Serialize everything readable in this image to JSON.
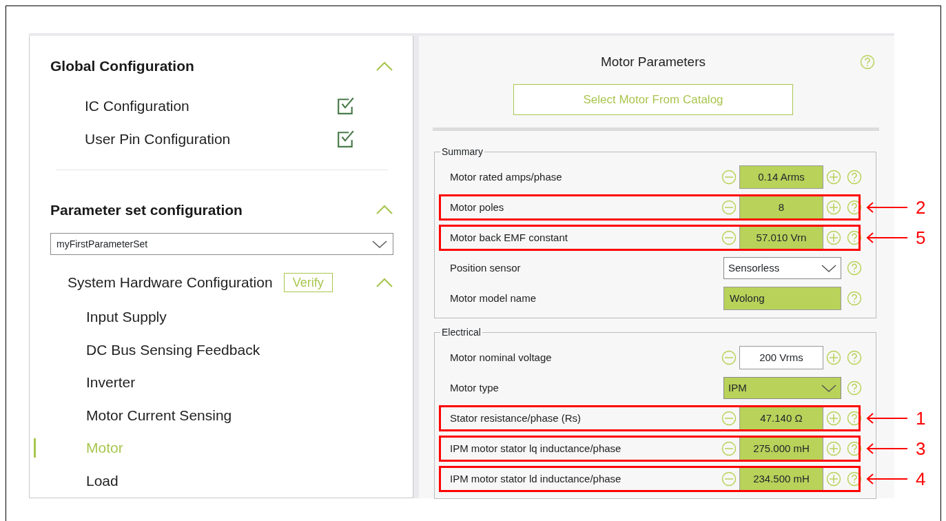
{
  "sidebar": {
    "sections": [
      {
        "title": "Global Configuration",
        "expanded": true,
        "items": [
          {
            "label": "IC Configuration",
            "checked": true
          },
          {
            "label": "User Pin Configuration",
            "checked": true
          }
        ]
      },
      {
        "title": "Parameter set configuration",
        "expanded": true,
        "parameter_set": "myFirstParameterSet",
        "subsection": {
          "title": "System Hardware Configuration",
          "verify_button": "Verify",
          "expanded": true,
          "items": [
            {
              "label": "Input Supply",
              "selected": false
            },
            {
              "label": "DC Bus Sensing Feedback",
              "selected": false
            },
            {
              "label": "Inverter",
              "selected": false
            },
            {
              "label": "Motor Current Sensing",
              "selected": false
            },
            {
              "label": "Motor",
              "selected": true
            },
            {
              "label": "Load",
              "selected": false
            }
          ]
        }
      }
    ]
  },
  "panel": {
    "title": "Motor Parameters",
    "catalog_button": "Select Motor From Catalog",
    "groups": [
      {
        "title": "Summary",
        "rows": [
          {
            "kind": "spin",
            "label": "Motor rated amps/phase",
            "value": "0.14 Arms",
            "changed": true
          },
          {
            "kind": "spin",
            "label": "Motor poles",
            "value": "8",
            "changed": true,
            "callout": "2"
          },
          {
            "kind": "spin",
            "label": "Motor back EMF constant",
            "value": "57.010 Vrn",
            "changed": true,
            "callout": "5"
          },
          {
            "kind": "select",
            "label": "Position sensor",
            "value": "Sensorless",
            "changed": false
          },
          {
            "kind": "text",
            "label": "Motor model name",
            "value": "Wolong",
            "changed": true
          }
        ]
      },
      {
        "title": "Electrical",
        "rows": [
          {
            "kind": "spin",
            "label": "Motor nominal voltage",
            "value": "200 Vrms",
            "changed": false
          },
          {
            "kind": "select",
            "label": "Motor type",
            "value": "IPM",
            "changed": true
          },
          {
            "kind": "spin",
            "label": "Stator resistance/phase (Rs)",
            "value": "47.140 Ω",
            "changed": true,
            "callout": "1"
          },
          {
            "kind": "spin",
            "label": "IPM motor stator lq inductance/phase",
            "value": "275.000 mH",
            "changed": true,
            "callout": "3"
          },
          {
            "kind": "spin",
            "label": "IPM motor stator ld inductance/phase",
            "value": "234.500 mH",
            "changed": true,
            "callout": "4"
          }
        ]
      }
    ]
  }
}
